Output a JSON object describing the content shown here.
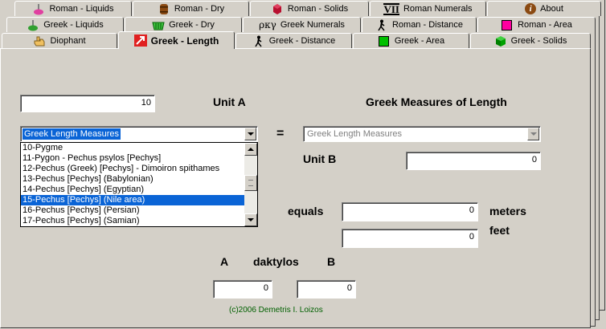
{
  "tabs_row1": [
    {
      "label": "Roman - Liquids",
      "icon": "flask-icon"
    },
    {
      "label": "Roman - Dry",
      "icon": "barrel-icon"
    },
    {
      "label": "Roman - Solids",
      "icon": "gem-icon"
    },
    {
      "label": "Roman Numerals",
      "icon": "roman-numeral-icon",
      "icon_text": "VII"
    },
    {
      "label": "About",
      "icon": "info-icon",
      "icon_text": "i"
    }
  ],
  "tabs_row2": [
    {
      "label": "Greek - Liquids",
      "icon": "flask-icon"
    },
    {
      "label": "Greek - Dry",
      "icon": "basket-icon"
    },
    {
      "label": "Greek  Numerals",
      "icon": "greek-numeral-icon",
      "icon_text": "ρκγ"
    },
    {
      "label": "Roman - Distance",
      "icon": "walker-icon"
    },
    {
      "label": "Roman - Area",
      "icon": "square-icon",
      "color": "#ff00a0"
    }
  ],
  "tabs_row3": [
    {
      "label": "Diophant",
      "icon": "hand-icon"
    },
    {
      "label": "Greek  -  Length",
      "icon": "arrow-icon",
      "active": true
    },
    {
      "label": "Greek - Distance",
      "icon": "walker-icon"
    },
    {
      "label": "Greek - Area",
      "icon": "square-icon",
      "color": "#00c000"
    },
    {
      "label": "Greek - Solids",
      "icon": "cube-icon",
      "color": "#00a000"
    }
  ],
  "unit_a_value": "10",
  "unit_a_label": "Unit  A",
  "section_title": "Greek Measures of Length",
  "combo_a": {
    "selected": "Greek Length Measures"
  },
  "equals_sign": "=",
  "combo_b": {
    "selected": "Greek Length Measures"
  },
  "list_items": [
    "10-Pygme",
    "11-Pygon - Pechus psylos [Pechys]",
    "12-Pechus (Greek) [Pechys] - Dimoiron spithames",
    "13-Pechus [Pechys] (Babylonian)",
    "14-Pechus [Pechys] (Egyptian)",
    "15-Pechus [Pechys] (Nile area)",
    "16-Pechus [Pechys] (Persian)",
    "17-Pechus [Pechys] (Samian)"
  ],
  "list_selected_index": 5,
  "unit_b_label": "Unit  B",
  "unit_b_value": "0",
  "equals_label": "equals",
  "meters_value": "0",
  "meters_label": "meters",
  "feet_value": "0",
  "feet_label": "feet",
  "a_label": "A",
  "daktylos_label": "daktylos",
  "b_label": "B",
  "daktylos_a_value": "0",
  "daktylos_b_value": "0",
  "copyright": "(c)2006  Demetris I. Loizos",
  "colors": {
    "selection": "#0a64d6",
    "copyright": "#006000",
    "roman_area": "#ff00a0",
    "greek_area": "#00c000"
  }
}
